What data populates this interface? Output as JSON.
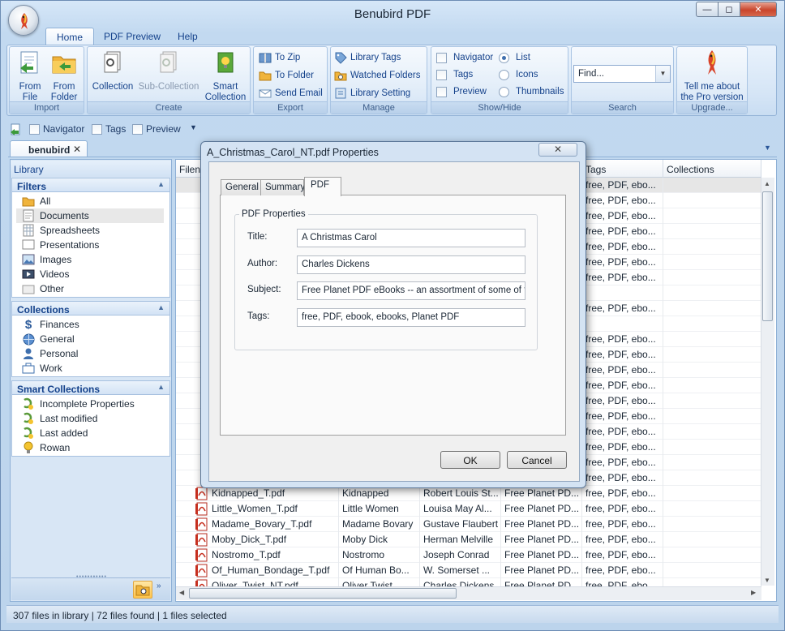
{
  "window": {
    "title": "Benubird PDF",
    "min": "—",
    "max": "◻",
    "close": "✕"
  },
  "ribbon": {
    "tabs": [
      "Home",
      "PDF Preview",
      "Help"
    ],
    "import": {
      "caption": "Import",
      "from_file": [
        "From",
        "File"
      ],
      "from_folder": [
        "From",
        "Folder"
      ]
    },
    "create": {
      "caption": "Create",
      "collection": "Collection",
      "sub_collection": "Sub-Collection",
      "smart_collection": [
        "Smart",
        "Collection"
      ]
    },
    "export": {
      "caption": "Export",
      "to_zip": "To Zip",
      "to_folder": "To Folder",
      "send_email": "Send Email"
    },
    "manage": {
      "caption": "Manage",
      "library_tags": "Library Tags",
      "watched_folders": "Watched Folders",
      "library_setting": "Library Setting"
    },
    "showhide": {
      "caption": "Show/Hide",
      "navigator": "Navigator",
      "tags": "Tags",
      "preview": "Preview",
      "list": "List",
      "icons": "Icons",
      "thumbnails": "Thumbnails"
    },
    "search": {
      "caption": "Search",
      "placeholder": "Find..."
    },
    "upgrade": {
      "caption": "Upgrade...",
      "tell_me": [
        "Tell me about",
        "the Pro version"
      ]
    }
  },
  "quickbar": {
    "navigator": "Navigator",
    "tags": "Tags",
    "preview": "Preview"
  },
  "doctab": {
    "label": "benubird",
    "close": "✕"
  },
  "library": {
    "header": "Library",
    "filters": {
      "title": "Filters",
      "items": [
        "All",
        "Documents",
        "Spreadsheets",
        "Presentations",
        "Images",
        "Videos",
        "Other"
      ]
    },
    "collections": {
      "title": "Collections",
      "items": [
        "Finances",
        "General",
        "Personal",
        "Work"
      ]
    },
    "smart": {
      "title": "Smart Collections",
      "items": [
        "Incomplete Properties",
        "Last modified",
        "Last added",
        "Rowan"
      ]
    }
  },
  "grid": {
    "columns": [
      "Filen",
      "Tags",
      "Collections"
    ],
    "tags_column_rows": [
      "free, PDF, ebo...",
      "free, PDF, ebo...",
      "free, PDF, ebo...",
      "free, PDF, ebo...",
      "free, PDF, ebo...",
      "free, PDF, ebo...",
      "free, PDF, ebo...",
      "",
      "free, PDF, ebo...",
      "",
      "free, PDF, ebo...",
      "free, PDF, ebo...",
      "free, PDF, ebo...",
      "free, PDF, ebo...",
      "free, PDF, ebo...",
      "free, PDF, ebo...",
      "free, PDF, ebo...",
      "free, PDF, ebo...",
      "free, PDF, ebo...",
      "free, PDF, ebo..."
    ],
    "rows": [
      [
        "Kidnapped_T.pdf",
        "Kidnapped",
        "Robert Louis St...",
        "Free Planet PD...",
        "free, PDF, ebo..."
      ],
      [
        "Little_Women_T.pdf",
        "Little Women",
        "Louisa May Al...",
        "Free Planet PD...",
        "free, PDF, ebo..."
      ],
      [
        "Madame_Bovary_T.pdf",
        "Madame Bovary",
        "Gustave Flaubert",
        "Free Planet PD...",
        "free, PDF, ebo..."
      ],
      [
        "Moby_Dick_T.pdf",
        "Moby Dick",
        "Herman Melville",
        "Free Planet PD...",
        "free, PDF, ebo..."
      ],
      [
        "Nostromo_T.pdf",
        "Nostromo",
        "Joseph Conrad",
        "Free Planet PD...",
        "free, PDF, ebo..."
      ],
      [
        "Of_Human_Bondage_T.pdf",
        "Of Human Bo...",
        "W. Somerset ...",
        "Free Planet PD...",
        "free, PDF, ebo..."
      ],
      [
        "Oliver_Twist_NT.pdf",
        "Oliver Twist",
        "Charles Dickens",
        "Free Planet PD...",
        "free, PDF, ebo..."
      ]
    ]
  },
  "status": "307 files in library | 72 files found | 1 files selected",
  "dialog": {
    "title": "A_Christmas_Carol_NT.pdf Properties",
    "close": "✕",
    "tabs": [
      "General",
      "Summary",
      "PDF"
    ],
    "group": "PDF Properties",
    "fields": [
      {
        "label": "Title:",
        "value": "A Christmas Carol"
      },
      {
        "label": "Author:",
        "value": "Charles Dickens"
      },
      {
        "label": "Subject:",
        "value": "Free Planet PDF eBooks -- an assortment of some of the"
      },
      {
        "label": "Tags:",
        "value": "free, PDF, ebook, ebooks, Planet PDF"
      }
    ],
    "ok": "OK",
    "cancel": "Cancel"
  }
}
